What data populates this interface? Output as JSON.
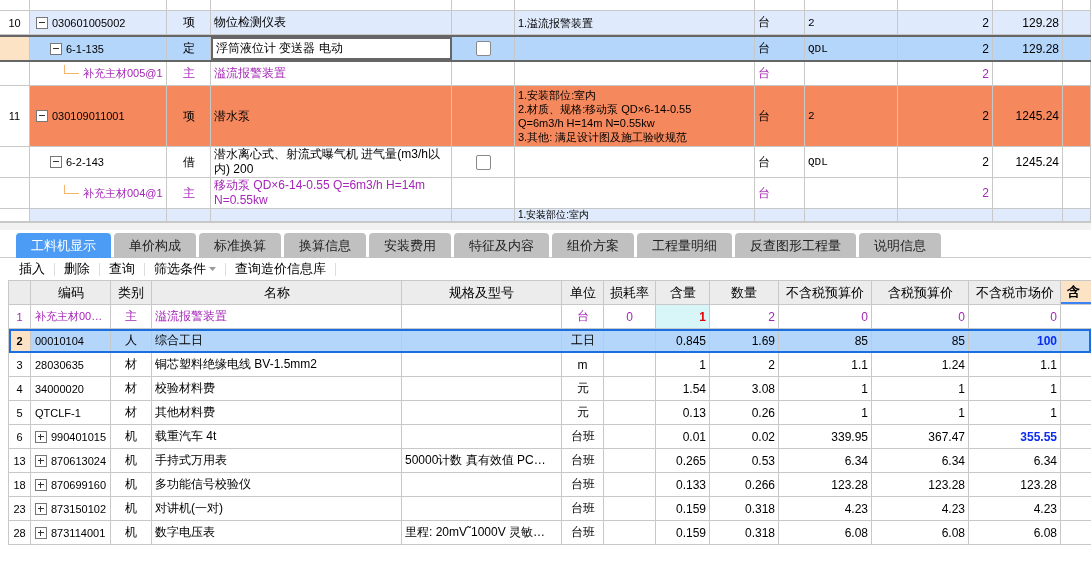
{
  "top_grid": {
    "rows": [
      {
        "num": "10",
        "code": "030601005002",
        "kind": "item",
        "type": "项",
        "name": "物位检测仪表",
        "features": [
          "1.溢流报警装置"
        ],
        "unit": "台",
        "expr": "2",
        "qty": "2",
        "price": "129.28",
        "highlighted": false,
        "selected": false,
        "expanded": true,
        "children": [
          {
            "code": "6-1-135",
            "kind": "quota",
            "type": "定",
            "name": "浮筒液位计 变送器 电动",
            "checked": false,
            "unit": "台",
            "expr": "QDL",
            "qty": "2",
            "price": "129.28",
            "highlighted": false,
            "selected": true,
            "expanded": true,
            "children": [
              {
                "code": "补充主材005@1",
                "kind": "material",
                "type": "主",
                "name": "溢流报警装置",
                "unit": "台",
                "qty": "2",
                "highlighted": false,
                "selected": false
              }
            ]
          }
        ]
      },
      {
        "num": "11",
        "code": "030109011001",
        "kind": "item",
        "type": "项",
        "name": "潜水泵",
        "features": [
          "1.安装部位:室内",
          "2.材质、规格:移动泵 QD×6-14-0.55",
          "Q=6m3/h H=14m N=0.55kw",
          "3.其他: 满足设计图及施工验收规范"
        ],
        "unit": "台",
        "expr": "2",
        "qty": "2",
        "price": "1245.24",
        "highlighted": true,
        "selected": false,
        "expanded": true,
        "children": [
          {
            "code": "6-2-143",
            "kind": "quota",
            "type": "借",
            "name": "潜水离心式、射流式曝气机 进气量(m3/h以内) 200",
            "checked": false,
            "unit": "台",
            "expr": "QDL",
            "qty": "2",
            "price": "1245.24",
            "highlighted": false,
            "selected": false,
            "expanded": true,
            "children": [
              {
                "code": "补充主材004@1",
                "kind": "material",
                "type": "主",
                "name": "移动泵 QD×6-14-0.55 Q=6m3/h H=14m N=0.55kw",
                "unit": "台",
                "qty": "2",
                "highlighted": false,
                "selected": false
              }
            ]
          }
        ]
      },
      {
        "kind": "item",
        "features": [
          "1.安装部位:室内"
        ],
        "highlighted": false,
        "selected": false
      }
    ]
  },
  "tabs": [
    {
      "label": "工料机显示",
      "selected": true
    },
    {
      "label": "单价构成",
      "selected": false
    },
    {
      "label": "标准换算",
      "selected": false
    },
    {
      "label": "换算信息",
      "selected": false
    },
    {
      "label": "安装费用",
      "selected": false
    },
    {
      "label": "特征及内容",
      "selected": false
    },
    {
      "label": "组价方案",
      "selected": false
    },
    {
      "label": "工程量明细",
      "selected": false
    },
    {
      "label": "反查图形工程量",
      "selected": false
    },
    {
      "label": "说明信息",
      "selected": false
    }
  ],
  "toolbar": [
    {
      "label": "插入",
      "kind": "button"
    },
    {
      "label": "删除",
      "kind": "button"
    },
    {
      "label": "查询",
      "kind": "button"
    },
    {
      "label": "筛选条件",
      "kind": "dropdown"
    },
    {
      "label": "查询造价信息库",
      "kind": "button"
    }
  ],
  "table": {
    "columns": [
      "编码",
      "类别",
      "名称",
      "规格及型号",
      "单位",
      "损耗率",
      "含量",
      "数量",
      "不含税预算价",
      "含税预算价",
      "不含税市场价",
      "含"
    ],
    "rows": [
      {
        "num": "1",
        "code": "补充主材00…",
        "kind": "material",
        "expandable": false,
        "type": "主",
        "name": "溢流报警装置",
        "spec": "",
        "unit": "台",
        "loss": "0",
        "content": "1",
        "content_edited": true,
        "qty": "2",
        "budget": "0",
        "budget_tax": "0",
        "market": "0",
        "market_adjusted": false,
        "selected": false
      },
      {
        "num": "2",
        "code": "00010104",
        "kind": "normal",
        "expandable": false,
        "type": "人",
        "name": "综合工日",
        "spec": "",
        "unit": "工日",
        "loss": "",
        "content": "0.845",
        "content_edited": false,
        "qty": "1.69",
        "budget": "85",
        "budget_tax": "85",
        "market": "100",
        "market_adjusted": true,
        "selected": true
      },
      {
        "num": "3",
        "code": "28030635",
        "kind": "normal",
        "expandable": false,
        "type": "材",
        "name": "铜芯塑料绝缘电线 BV-1.5mm2",
        "spec": "",
        "unit": "m",
        "loss": "",
        "content": "1",
        "content_edited": false,
        "qty": "2",
        "budget": "1.1",
        "budget_tax": "1.24",
        "market": "1.1",
        "market_adjusted": false,
        "selected": false
      },
      {
        "num": "4",
        "code": "34000020",
        "kind": "normal",
        "expandable": false,
        "type": "材",
        "name": "校验材料费",
        "spec": "",
        "unit": "元",
        "loss": "",
        "content": "1.54",
        "content_edited": false,
        "qty": "3.08",
        "budget": "1",
        "budget_tax": "1",
        "market": "1",
        "market_adjusted": false,
        "selected": false
      },
      {
        "num": "5",
        "code": "QTCLF-1",
        "kind": "normal",
        "expandable": false,
        "type": "材",
        "name": "其他材料费",
        "spec": "",
        "unit": "元",
        "loss": "",
        "content": "0.13",
        "content_edited": false,
        "qty": "0.26",
        "budget": "1",
        "budget_tax": "1",
        "market": "1",
        "market_adjusted": false,
        "selected": false
      },
      {
        "num": "6",
        "code": "990401015",
        "kind": "normal",
        "expandable": true,
        "type": "机",
        "name": "载重汽车 4t",
        "spec": "",
        "unit": "台班",
        "loss": "",
        "content": "0.01",
        "content_edited": false,
        "qty": "0.02",
        "budget": "339.95",
        "budget_tax": "367.47",
        "market": "355.55",
        "market_adjusted": true,
        "selected": false
      },
      {
        "num": "13",
        "code": "870613024",
        "kind": "normal",
        "expandable": true,
        "type": "机",
        "name": "手持式万用表",
        "spec": "50000计数 真有效值 PC…",
        "unit": "台班",
        "loss": "",
        "content": "0.265",
        "content_edited": false,
        "qty": "0.53",
        "budget": "6.34",
        "budget_tax": "6.34",
        "market": "6.34",
        "market_adjusted": false,
        "selected": false
      },
      {
        "num": "18",
        "code": "870699160",
        "kind": "normal",
        "expandable": true,
        "type": "机",
        "name": "多功能信号校验仪",
        "spec": "",
        "unit": "台班",
        "loss": "",
        "content": "0.133",
        "content_edited": false,
        "qty": "0.266",
        "budget": "123.28",
        "budget_tax": "123.28",
        "market": "123.28",
        "market_adjusted": false,
        "selected": false
      },
      {
        "num": "23",
        "code": "873150102",
        "kind": "normal",
        "expandable": true,
        "type": "机",
        "name": "对讲机(一对)",
        "spec": "",
        "unit": "台班",
        "loss": "",
        "content": "0.159",
        "content_edited": false,
        "qty": "0.318",
        "budget": "4.23",
        "budget_tax": "4.23",
        "market": "4.23",
        "market_adjusted": false,
        "selected": false
      },
      {
        "num": "28",
        "code": "873114001",
        "kind": "normal",
        "expandable": true,
        "type": "机",
        "name": "数字电压表",
        "spec": "里程: 20mV˜1000V 灵敏…",
        "unit": "台班",
        "loss": "",
        "content": "0.159",
        "content_edited": false,
        "qty": "0.318",
        "budget": "6.08",
        "budget_tax": "6.08",
        "market": "6.08",
        "market_adjusted": false,
        "selected": false
      }
    ]
  }
}
